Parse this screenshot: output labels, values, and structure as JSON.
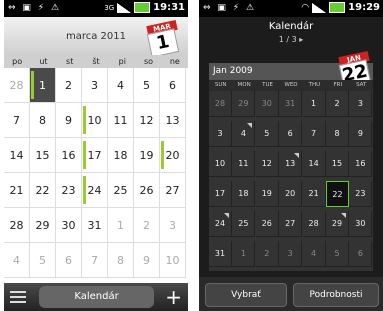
{
  "left": {
    "status_time": "19:31",
    "network_label": "3G",
    "month_title": "marca 2011",
    "cal_icon": {
      "month": "MAR",
      "day": "1"
    },
    "weekdays": [
      "po",
      "ut",
      "st",
      "št",
      "pi",
      "so",
      "ne"
    ],
    "weeks": [
      [
        "28",
        "1",
        "2",
        "3",
        "4",
        "5",
        "6"
      ],
      [
        "7",
        "8",
        "9",
        "10",
        "11",
        "12",
        "13"
      ],
      [
        "14",
        "15",
        "16",
        "17",
        "18",
        "19",
        "20"
      ],
      [
        "21",
        "22",
        "23",
        "24",
        "25",
        "26",
        "27"
      ],
      [
        "28",
        "29",
        "30",
        "31",
        "1",
        "2",
        "3"
      ],
      [
        "4",
        "5",
        "6",
        "7",
        "8",
        "9",
        "10"
      ]
    ],
    "bottom_tab": "Kalendár",
    "add_label": "+"
  },
  "right": {
    "status_time": "19:29",
    "title": "Kalendár",
    "page": "1 / 3 ▸",
    "cal_icon": {
      "month": "JAN",
      "day": "22"
    },
    "month_bar": "Jan 2009",
    "weekdays": [
      "SUN",
      "MON",
      "TUE",
      "WED",
      "THU",
      "FRI",
      "SAT"
    ],
    "weeks": [
      [
        "28",
        "29",
        "30",
        "31",
        "1",
        "2",
        "3"
      ],
      [
        "3",
        "4",
        "5",
        "6",
        "7",
        "8",
        "9"
      ],
      [
        "10",
        "11",
        "12",
        "13",
        "14",
        "15",
        "16"
      ],
      [
        "17",
        "18",
        "19",
        "20",
        "21",
        "22",
        "23"
      ],
      [
        "24",
        "25",
        "26",
        "27",
        "28",
        "29",
        "30"
      ],
      [
        "31",
        "1",
        "2",
        "3",
        "4",
        "5",
        "6"
      ]
    ],
    "btn_left": "Vybrať",
    "btn_right": "Podrobnosti"
  }
}
